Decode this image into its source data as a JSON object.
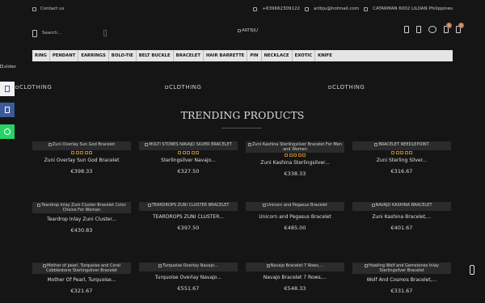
{
  "topbar": {
    "contact": "Contact us",
    "phone": "+639662309122",
    "email": "artbju@hotmail.com",
    "address": "CATARMAN 6002 LILOAN Philippines"
  },
  "header": {
    "search_placeholder": "Search...",
    "logo_alt": "ARTBJU",
    "cart_count": "0",
    "wishlist_count": "0"
  },
  "nav": {
    "items": [
      "RING",
      "PENDANT",
      "EARRINGS",
      "BOLO-TIE",
      "BELT BUCKLE",
      "BRACELET",
      "HAIR BARRETTE",
      "PIN",
      "NECKLACE",
      "EXOTIC",
      "KNIFE"
    ]
  },
  "slider": {
    "alt": "slider"
  },
  "categories": [
    "CLOTHING",
    "CLOTHING",
    "CLOTHING"
  ],
  "trending": {
    "title": "TRENDING PRODUCTS",
    "products": [
      {
        "alt": "Zuni Overlay Sun God Bracelet",
        "name": "Zuni Overlay Sun God Bracelet",
        "price": "€398.33"
      },
      {
        "alt": "MULTI STONES NAVAJO SILVER BRACELET",
        "name": "Sterlingsilver Navajo...",
        "price": "€327.50"
      },
      {
        "alt": "Zuni Kashina Sterlingsilver Bracelet For Men and Women",
        "name": "Zuni Kashina Sterlingsilver...",
        "price": "€338.33"
      },
      {
        "alt": "BRACELET NEEDLEPOINT",
        "name": "Zuni Sterling Silver...",
        "price": "€316.67"
      },
      {
        "alt": "Teardrop Inlay Zuni Cluster Bracelet Color Choice For Woman",
        "name": "Teardrop Inlay Zuni Cluster...",
        "price": "€430.83"
      },
      {
        "alt": "TEARDROPS ZUNI CLUSTER BRACELET",
        "name": "TEARDROPS ZUNI CLUSTER...",
        "price": "€397.50"
      },
      {
        "alt": "Unicorn and Pegasus Bracelet",
        "name": "Unicorn and Pegasus Bracelet",
        "price": "€485.00"
      },
      {
        "alt": "NAVAJO KASHINA BRACELET",
        "name": "Zuni Kashina Bracelet,...",
        "price": "€401.67"
      },
      {
        "alt": "Mother of pearl, Turquoise and Coral Cobblestone Sterlingsilver Bracelet",
        "name": "Mother Of Pearl, Turquoise...",
        "price": "€321.67"
      },
      {
        "alt": "Turquoise Overlay Navajo...",
        "name": "Turquoise Overlay Navajo...",
        "price": "€551.67"
      },
      {
        "alt": "Navajo Bracelet 7 Rows,...",
        "name": "Navajo Bracelet 7 Rows,...",
        "price": "€548.33"
      },
      {
        "alt": "Howling Wolf and Gemstones Inlay Sterlingsilver Bracelet",
        "name": "Wolf And Cosmos Bracelet,...",
        "price": "€331.67"
      }
    ]
  },
  "colors": {
    "background": "#151515",
    "nav_bg": "#e5e5e5",
    "star": "#b0802a",
    "badge": "#c0734e",
    "facebook": "#3d5a98",
    "whatsapp": "#25d366"
  }
}
